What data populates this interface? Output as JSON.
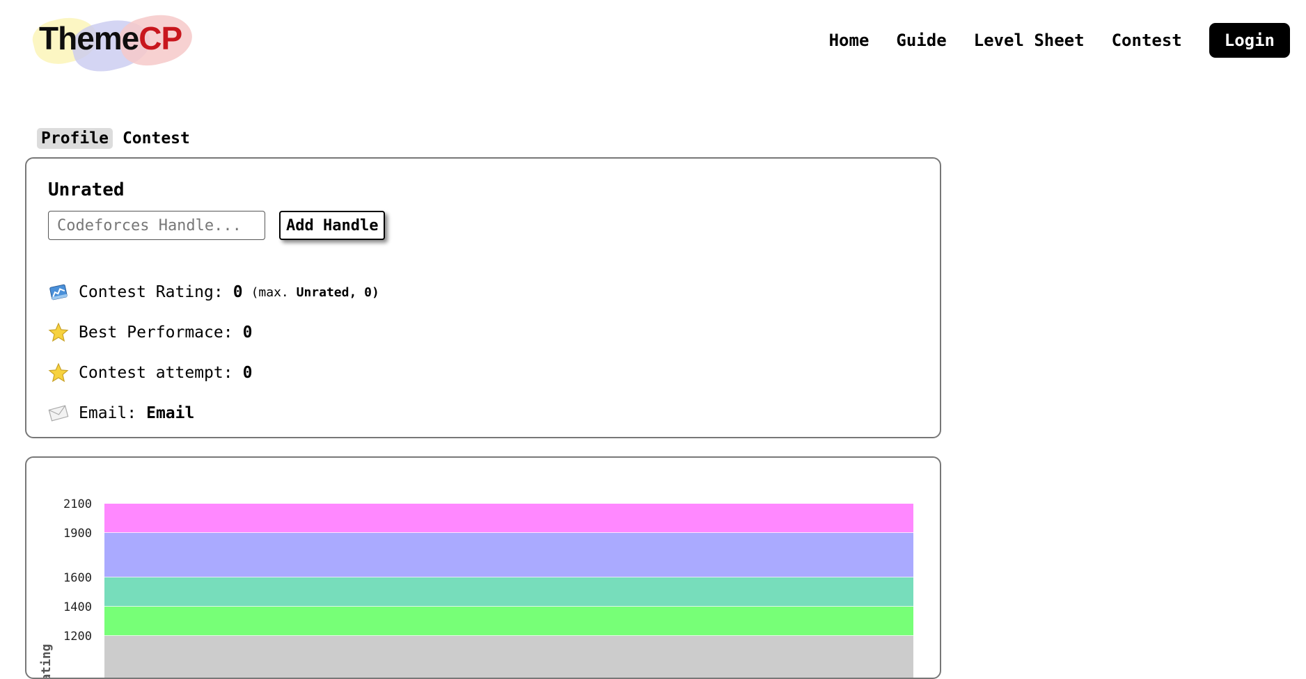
{
  "brand": {
    "part1": "Theme",
    "part2": "CP",
    "accent": "#c8161d"
  },
  "nav": {
    "links": [
      "Home",
      "Guide",
      "Level Sheet",
      "Contest"
    ],
    "login": "Login"
  },
  "tabs": {
    "profile": "Profile",
    "contest": "Contest"
  },
  "profile": {
    "rank": "Unrated",
    "handle_placeholder": "Codeforces Handle...",
    "add_handle_label": "Add Handle",
    "stats": {
      "rating_label": "Contest Rating:",
      "rating_value": "0",
      "rating_max_label": "(max.",
      "rating_max_value": "Unrated, 0)",
      "best_label": "Best Performace:",
      "best_value": "0",
      "attempt_label": "Contest attempt:",
      "attempt_value": "0",
      "email_label": "Email:",
      "email_value": "Email"
    },
    "icons": {
      "rating": "rating-chart-icon",
      "best": "star-icon",
      "attempt": "star-icon",
      "email": "envelope-icon"
    }
  },
  "chart_data": {
    "type": "area",
    "title": "",
    "ylabel": "Rating",
    "yticks": [
      2100,
      1900,
      1600,
      1400,
      1200
    ],
    "bands": [
      {
        "from": 1900,
        "to": 2100,
        "color": "#ff88ff"
      },
      {
        "from": 1600,
        "to": 1900,
        "color": "#aaaaff"
      },
      {
        "from": 1400,
        "to": 1600,
        "color": "#77ddbb"
      },
      {
        "from": 1200,
        "to": 1400,
        "color": "#77ff77"
      },
      {
        "from": 0,
        "to": 1200,
        "color": "#cccccc"
      }
    ],
    "series": []
  }
}
